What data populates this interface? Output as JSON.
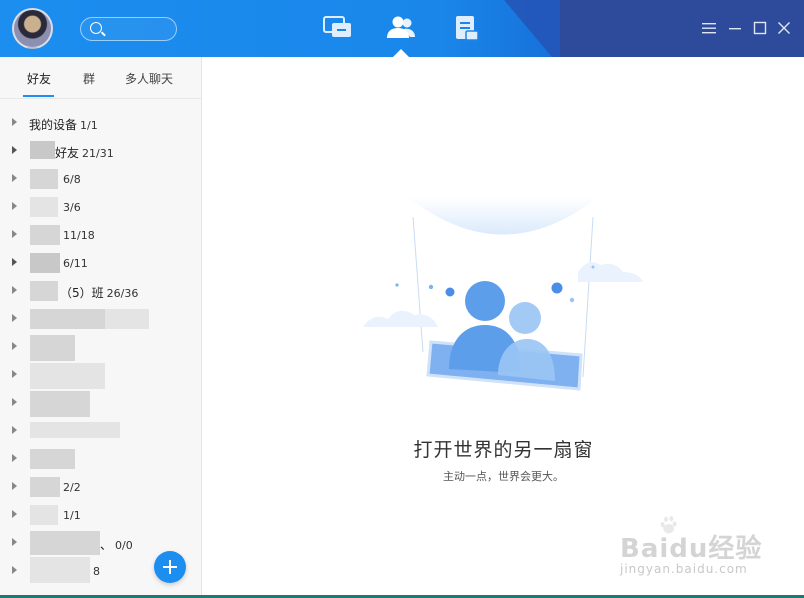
{
  "search": {
    "placeholder": ""
  },
  "nav": {
    "messages": "messages-icon",
    "contacts": "contacts-icon",
    "apps": "apps-icon"
  },
  "window": {
    "menu": "menu-icon",
    "minimize": "minimize-icon",
    "maximize": "maximize-icon",
    "close": "close-icon"
  },
  "tabs": [
    {
      "label": "好友",
      "active": true
    },
    {
      "label": "群",
      "active": false
    },
    {
      "label": "多人聊天",
      "active": false
    }
  ],
  "groups": [
    {
      "name": "我的设备",
      "count": "1/1"
    },
    {
      "name": "好友",
      "count": "21/31"
    },
    {
      "name": "",
      "count": "6/8"
    },
    {
      "name": "",
      "count": "3/6"
    },
    {
      "name": "",
      "count": "11/18"
    },
    {
      "name": "",
      "count": "6/11"
    },
    {
      "name": "（5）班",
      "count": "26/36"
    },
    {
      "name": "",
      "count": ""
    },
    {
      "name": "",
      "count": ""
    },
    {
      "name": "",
      "count": ""
    },
    {
      "name": "",
      "count": ""
    },
    {
      "name": "",
      "count": ""
    },
    {
      "name": "",
      "count": ""
    },
    {
      "name": "",
      "count": "2/2"
    },
    {
      "name": "",
      "count": "1/1"
    },
    {
      "name": "、",
      "count": "0/0"
    },
    {
      "name": "",
      "count": "8"
    }
  ],
  "empty_state": {
    "headline": "打开世界的另一扇窗",
    "subline": "主动一点，世界会更大。"
  },
  "watermark": {
    "brand": "Baidu经验",
    "url": "jingyan.baidu.com"
  },
  "colors": {
    "accent": "#1b8ef0",
    "titlebar_dark": "#2e4a9a"
  }
}
